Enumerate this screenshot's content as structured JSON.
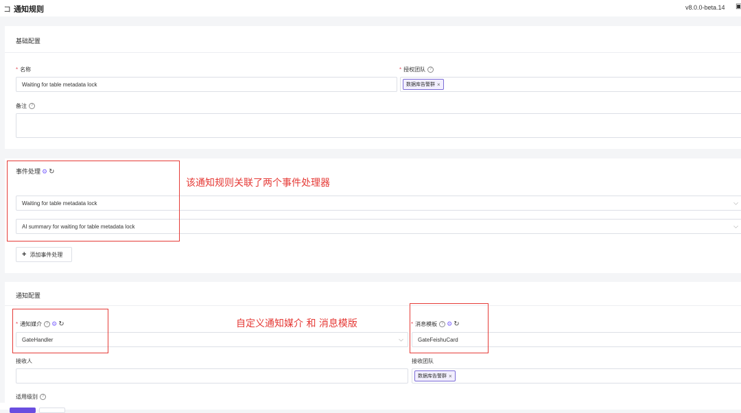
{
  "header": {
    "back_icon": "back-bracket-icon",
    "title": "通知规则",
    "version": "v8.0.0-beta.14",
    "right_icon": "panel-icon"
  },
  "basic": {
    "section_title": "基础配置",
    "name_label": "名称",
    "name_value": "Waiting for table metadata lock",
    "team_label": "授权团队",
    "team_tag": "数据库告警群",
    "note_label": "备注",
    "note_value": ""
  },
  "events": {
    "section_title": "事件处理",
    "processors": [
      "Waiting for table metadata lock",
      "AI summary for waiting for table metadata lock"
    ],
    "add_button": "添加事件处理",
    "annotation": "该通知规则关联了两个事件处理器"
  },
  "notify": {
    "section_title": "通知配置",
    "media_label": "通知媒介",
    "media_value": "GateHandler",
    "template_label": "消息模板",
    "template_value": "GateFeishuCard",
    "receiver_label": "接收人",
    "receiver_value": "",
    "receive_team_label": "接收团队",
    "receive_team_tag": "数据库告警群",
    "level_label": "适用级别",
    "annotation": "自定义通知媒介  和  消息模版"
  },
  "colors": {
    "accent": "#7b61ff",
    "required": "#e34d59",
    "annotation": "#e53935"
  }
}
